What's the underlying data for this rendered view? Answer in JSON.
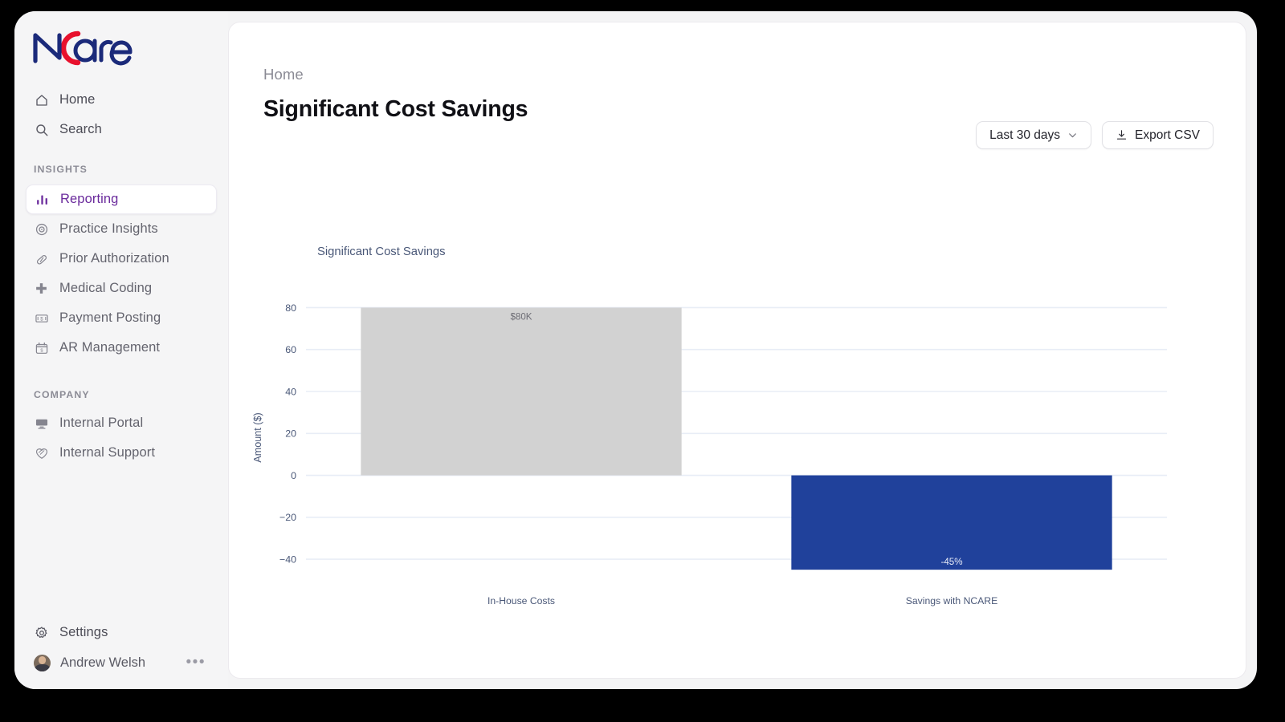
{
  "brand": {
    "name": "NCare",
    "name_dark": "N",
    "name_dark2": "are",
    "accent_red": "#e8112d",
    "navy": "#1b2a7a"
  },
  "sidebar": {
    "top_items": [
      {
        "label": "Home",
        "icon": "home-icon"
      },
      {
        "label": "Search",
        "icon": "search-icon"
      }
    ],
    "sections": [
      {
        "label": "INSIGHTS",
        "items": [
          {
            "label": "Reporting",
            "icon": "bar-chart-icon",
            "active": true
          },
          {
            "label": "Practice Insights",
            "icon": "target-icon",
            "active": false
          },
          {
            "label": "Prior Authorization",
            "icon": "pill-icon",
            "active": false
          },
          {
            "label": "Medical Coding",
            "icon": "medical-cross-icon",
            "active": false
          },
          {
            "label": "Payment Posting",
            "icon": "money-bill-icon",
            "active": false
          },
          {
            "label": "AR Management",
            "icon": "calendar-dollar-icon",
            "active": false
          }
        ]
      },
      {
        "label": "COMPANY",
        "items": [
          {
            "label": "Internal Portal",
            "icon": "monitor-icon",
            "active": false
          },
          {
            "label": "Internal Support",
            "icon": "heart-hands-icon",
            "active": false
          }
        ]
      }
    ],
    "settings": {
      "label": "Settings",
      "icon": "gear-icon"
    },
    "user": {
      "name": "Andrew Welsh",
      "more": "•••"
    },
    "active_color": "#6a2a9c"
  },
  "header": {
    "breadcrumb": "Home",
    "title": "Significant Cost Savings"
  },
  "toolbar": {
    "date_range_label": "Last 30 days",
    "export_label": "Export CSV"
  },
  "chart_data": {
    "type": "bar",
    "title": "Significant Cost Savings",
    "categories": [
      "In-House Costs",
      "Savings with NCARE"
    ],
    "values": [
      80,
      -45
    ],
    "data_labels": [
      "$80K",
      "-45%"
    ],
    "bar_colors": [
      "#d2d2d2",
      "#20419b"
    ],
    "label_colors": [
      "#6e6e76",
      "#e9ecf7"
    ],
    "xlabel": "",
    "ylabel": "Amount ($)",
    "ylim": [
      -48,
      84
    ],
    "yticks": [
      80,
      60,
      40,
      20,
      0,
      -20,
      -40
    ],
    "ytick_labels": [
      "80",
      "60",
      "40",
      "20",
      "0",
      "−20",
      "−40"
    ],
    "grid": true,
    "grid_color": "#e8edf6",
    "axis_text_color": "#4a5878",
    "legend": "none"
  }
}
